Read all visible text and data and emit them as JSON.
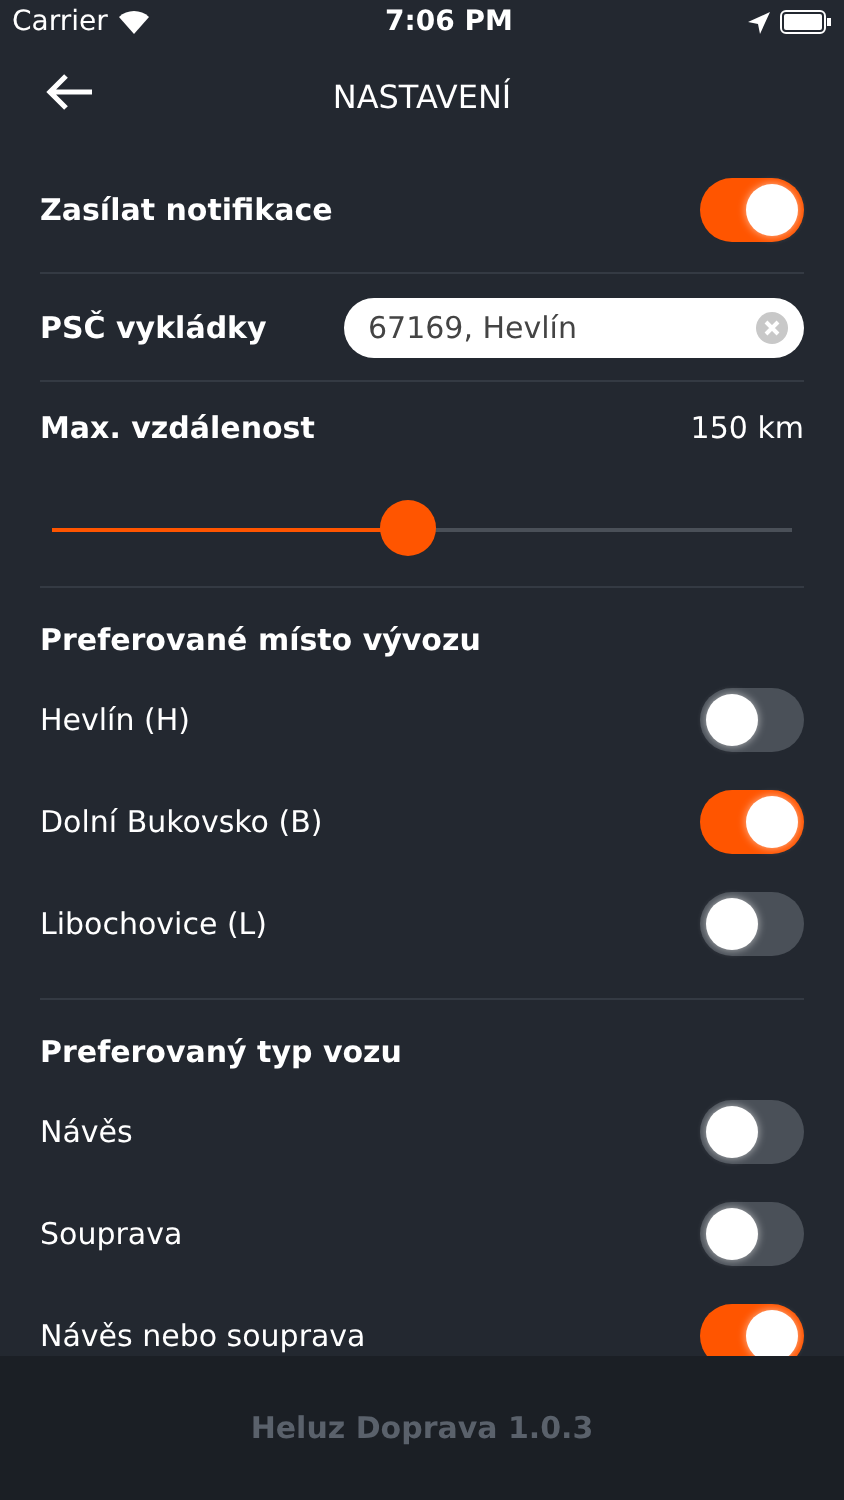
{
  "status_bar": {
    "carrier": "Carrier",
    "time": "7:06 PM"
  },
  "header": {
    "title": "NASTAVENÍ"
  },
  "notifications": {
    "label": "Zasílat notifikace",
    "on": true
  },
  "postcode": {
    "label": "PSČ vykládky",
    "value": "67169, Hevlín"
  },
  "distance": {
    "label": "Max. vzdálenost",
    "reading": "150 km",
    "level": 0.48
  },
  "sections": [
    {
      "title": "Preferované místo vývozu",
      "items": [
        {
          "label": "Hevlín (H)",
          "on": false
        },
        {
          "label": "Dolní Bukovsko (B)",
          "on": true
        },
        {
          "label": "Libochovice (L)",
          "on": false
        }
      ]
    },
    {
      "title": "Preferovaný typ vozu",
      "items": [
        {
          "label": "Návěs",
          "on": false
        },
        {
          "label": "Souprava",
          "on": false
        },
        {
          "label": "Návěs nebo souprava",
          "on": true
        }
      ]
    }
  ],
  "footer": {
    "version": "Heluz Doprava 1.0.3"
  }
}
